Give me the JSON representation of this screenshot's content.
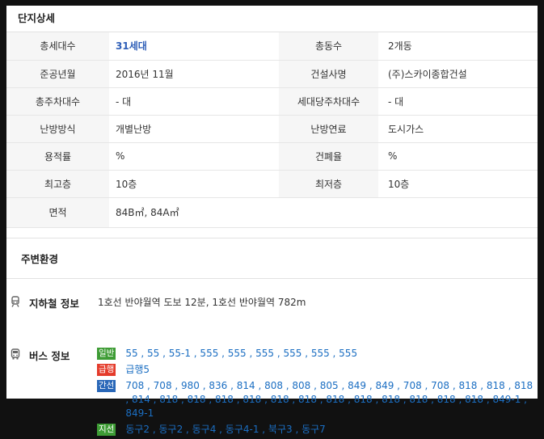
{
  "complex": {
    "title": "단지상세",
    "rows": [
      {
        "l1": "총세대수",
        "v1": "31세대",
        "l2": "총동수",
        "v2": "2개동"
      },
      {
        "l1": "준공년월",
        "v1": "2016년 11월",
        "l2": "건설사명",
        "v2": "(주)스카이종합건설"
      },
      {
        "l1": "총주차대수",
        "v1": "- 대",
        "l2": "세대당주차대수",
        "v2": "- 대"
      },
      {
        "l1": "난방방식",
        "v1": "개별난방",
        "l2": "난방연료",
        "v2": "도시가스"
      },
      {
        "l1": "용적률",
        "v1": "%",
        "l2": "건폐율",
        "v2": "%"
      },
      {
        "l1": "최고층",
        "v1": "10층",
        "l2": "최저층",
        "v2": "10층"
      },
      {
        "l1": "면적",
        "v1": "84B㎡, 84A㎡"
      }
    ]
  },
  "environment": {
    "title": "주변환경",
    "subway": {
      "label": "지하철 정보",
      "value": "1호선 반야월역 도보 12분, 1호선 반야월역 782m"
    },
    "bus": {
      "label": "버스 정보",
      "lines": [
        {
          "tag": "일반",
          "color": "#3e9c35",
          "routes": "55 , 55 , 55-1 , 555 , 555 , 555 , 555 , 555 , 555"
        },
        {
          "tag": "급행",
          "color": "#e43b2b",
          "routes": "급행5"
        },
        {
          "tag": "간선",
          "color": "#2967b8",
          "routes": "708 , 708 , 980 , 836 , 814 , 808 , 808 , 805 , 849 , 849 , 708 , 708 , 818 , 818 , 818 , 814 , 818 , 818 , 818 , 818 , 818 , 818 , 818 , 818 , 818 , 818 , 818 , 818 , 849-1 , 849-1"
        },
        {
          "tag": "지선",
          "color": "#3e9c35",
          "routes": "동구2 , 동구2 , 동구4 , 동구4-1 , 북구3 , 동구7"
        }
      ]
    }
  }
}
